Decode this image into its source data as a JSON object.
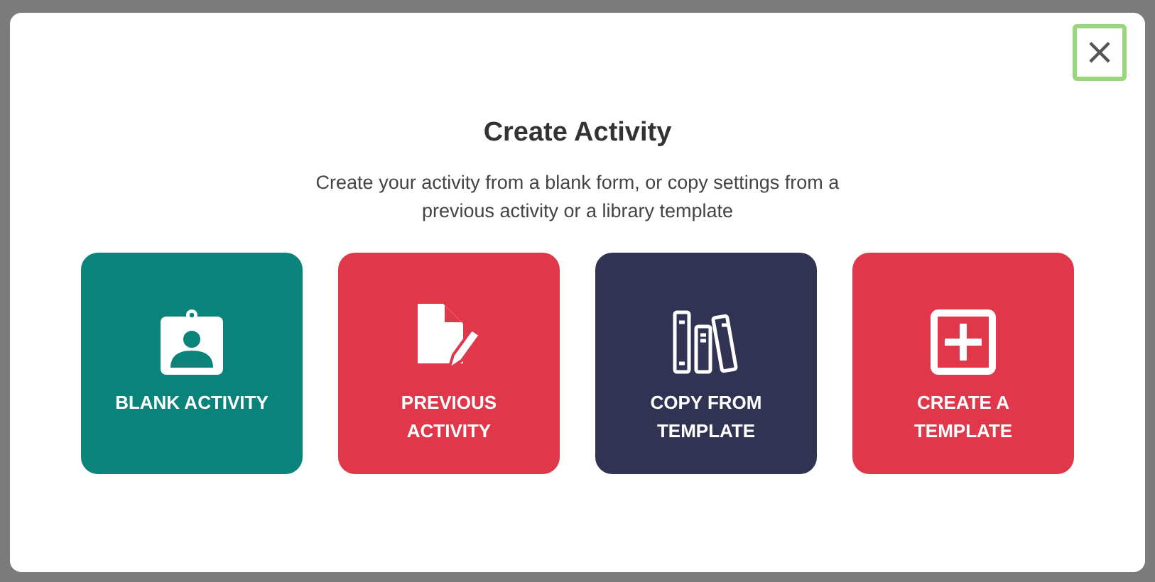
{
  "dialog": {
    "close_button": "×",
    "title": "Create Activity",
    "description": "Create your activity from a blank form, or copy settings from a previous activity or a library template",
    "options": [
      {
        "kind": "blank",
        "color": "#0a847b",
        "label": "BLANK ACTIVITY"
      },
      {
        "kind": "previous",
        "color": "#e0384a",
        "label": "PREVIOUS ACTIVITY"
      },
      {
        "kind": "copy",
        "color": "#303352",
        "label": "COPY FROM TEMPLATE"
      },
      {
        "kind": "create",
        "color": "#e0384a",
        "label": "CREATE A TEMPLATE"
      }
    ]
  }
}
